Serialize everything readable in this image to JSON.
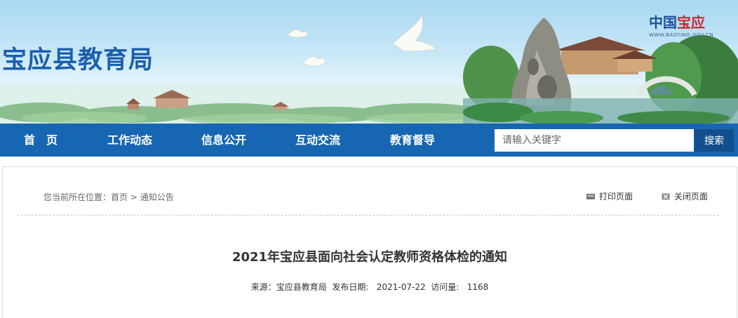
{
  "header": {
    "site_title": "宝应县教育局",
    "brand_part1": "中国",
    "brand_part2": "宝应",
    "brand_domain": "WWW.BAOYING.GOV.CN"
  },
  "nav": {
    "items": [
      {
        "label": "首　页"
      },
      {
        "label": "工作动态"
      },
      {
        "label": "信息公开"
      },
      {
        "label": "互动交流"
      },
      {
        "label": "教育督导"
      }
    ],
    "search_placeholder": "请输入关键字",
    "search_button": "搜索"
  },
  "breadcrumb": {
    "prefix": "您当前所在位置：",
    "home": "首页",
    "separator": " > ",
    "current": "通知公告"
  },
  "tools": {
    "print_label": "打印页面",
    "close_label": "关闭页面",
    "print_icon": "printer-icon",
    "close_icon": "close-icon"
  },
  "article": {
    "title": "2021年宝应县面向社会认定教师资格体检的通知",
    "source_label": "来源：",
    "source": "宝应县教育局",
    "date_label": "发布日期:",
    "date": "2021-07-22",
    "visits_label": "访问量:",
    "visits": "1168"
  },
  "colors": {
    "nav_bg": "#1766b2",
    "search_button_bg": "#134f8e",
    "title_blue": "#1b5fae",
    "brand_red": "#c8262d"
  }
}
